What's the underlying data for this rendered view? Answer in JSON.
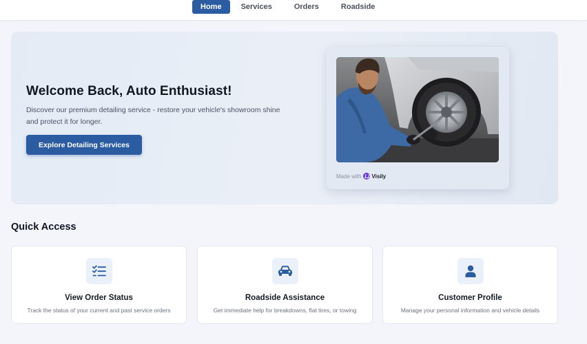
{
  "nav": {
    "items": [
      {
        "label": "Home",
        "active": true
      },
      {
        "label": "Services",
        "active": false
      },
      {
        "label": "Orders",
        "active": false
      },
      {
        "label": "Roadside",
        "active": false
      }
    ]
  },
  "hero": {
    "title": "Welcome Back, Auto Enthusiast!",
    "description": "Discover our premium detailing service - restore your vehicle's showroom shine and protect it for longer.",
    "cta_label": "Explore Detailing Services",
    "made_with_label": "Made with",
    "brand_name": "Visily"
  },
  "quick_access": {
    "title": "Quick Access",
    "cards": [
      {
        "icon": "checklist-icon",
        "title": "View Order Status",
        "description": "Track the status of your current and past service orders"
      },
      {
        "icon": "car-icon",
        "title": "Roadside Assistance",
        "description": "Get immediate help for breakdowns, flat tires, or towing"
      },
      {
        "icon": "user-icon",
        "title": "Customer Profile",
        "description": "Manage your personal information and vehicle details"
      }
    ]
  },
  "colors": {
    "primary": "#2b5ba0",
    "icon_bg": "#eaf1fb",
    "brand_purple": "#6a3be0"
  }
}
